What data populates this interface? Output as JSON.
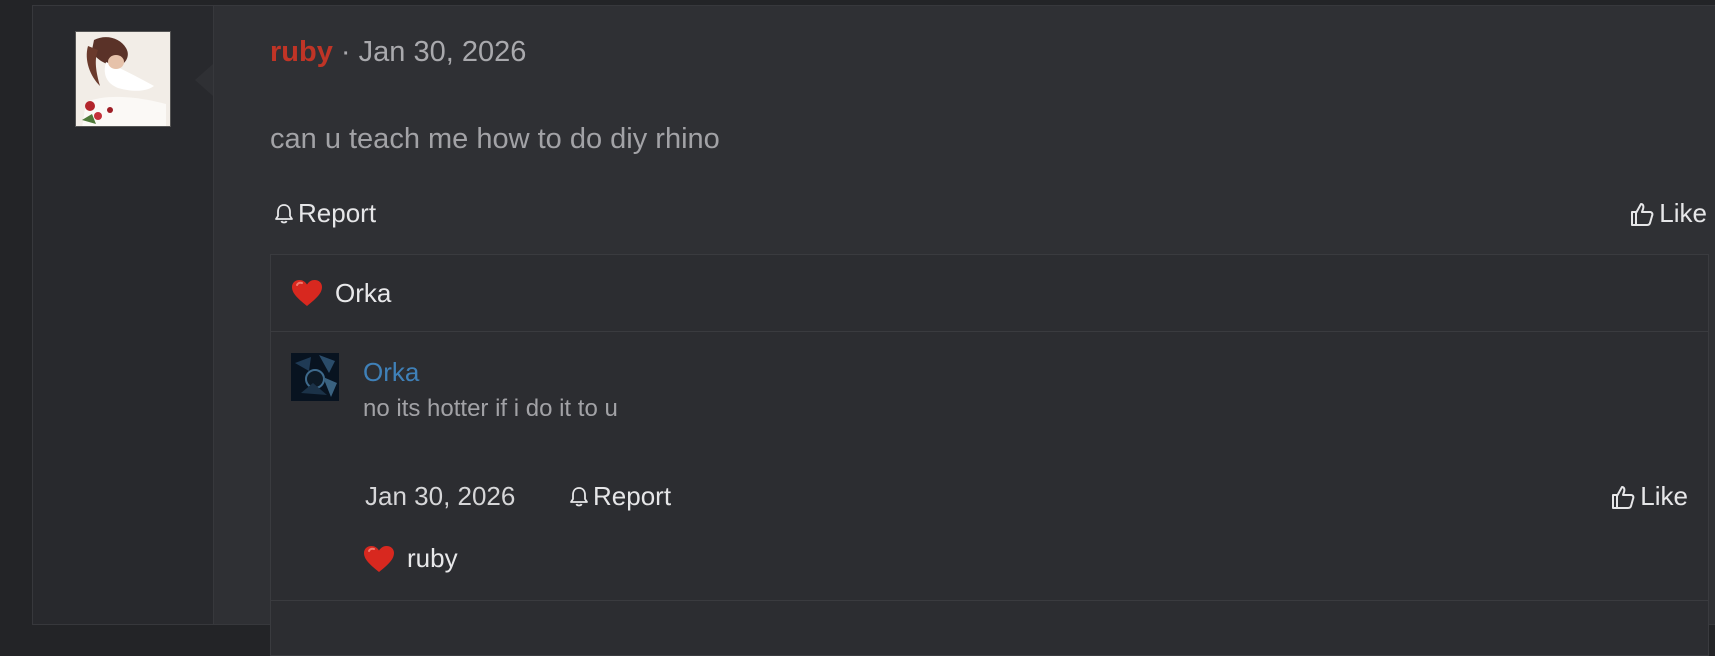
{
  "post": {
    "username": "ruby",
    "separator": "·",
    "date": "Jan 30, 2026",
    "body": "can u teach me how to do diy rhino",
    "report_label": "Report",
    "like_label": "Like",
    "reaction_user": "Orka"
  },
  "comment": {
    "author": "Orka",
    "text": "no its hotter if i do it to u",
    "date": "Jan 30, 2026",
    "report_label": "Report",
    "like_label": "Like",
    "reaction_user": "ruby"
  },
  "icons": {
    "report": "bell-icon",
    "like": "thumbs-up-icon",
    "reaction": "heart-icon"
  },
  "colors": {
    "username": "#c03426",
    "comment_author": "#3f80b8",
    "heart": "#d8281f",
    "background": "#2f3034"
  }
}
